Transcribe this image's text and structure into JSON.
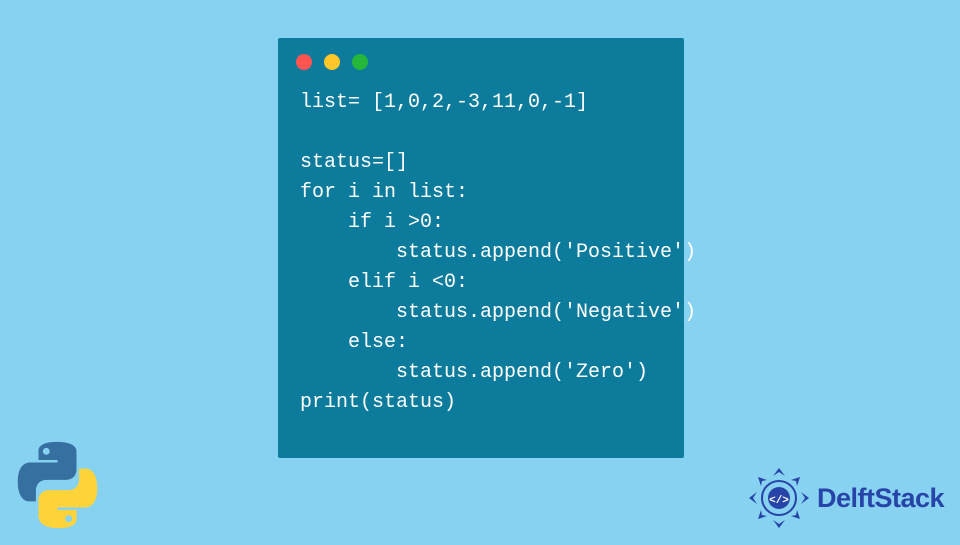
{
  "code_window": {
    "traffic_lights": [
      "red",
      "yellow",
      "green"
    ],
    "lines": [
      "list= [1,0,2,-3,11,0,-1]",
      "",
      "status=[]",
      "for i in list:",
      "    if i >0:",
      "        status.append('Positive')",
      "    elif i <0:",
      "        status.append('Negative')",
      "    else:",
      "        status.append('Zero')",
      "print(status)"
    ]
  },
  "brand": {
    "name": "DelftStack"
  },
  "colors": {
    "page_bg": "#87d2f0",
    "window_bg": "#0c7b9c",
    "text": "#ffffff",
    "brand_blue": "#2744a8",
    "python_blue": "#3570a0",
    "python_yellow": "#ffd43b"
  }
}
